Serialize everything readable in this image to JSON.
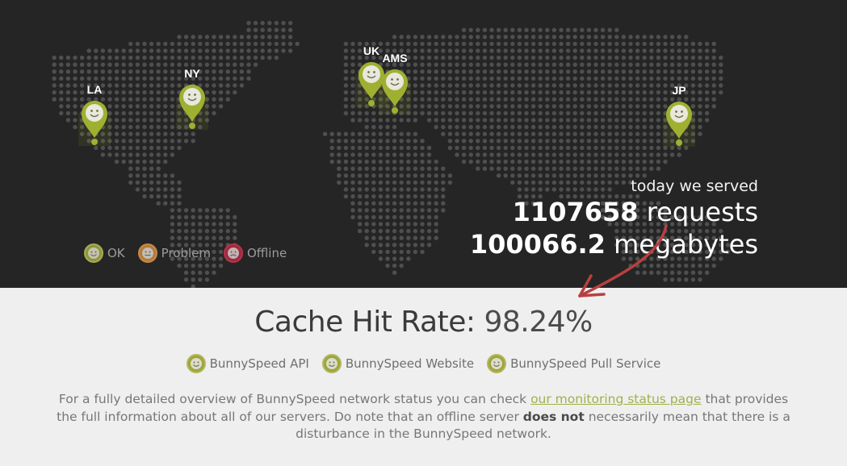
{
  "map": {
    "locations": [
      {
        "code": "LA",
        "status": "ok"
      },
      {
        "code": "NY",
        "status": "ok"
      },
      {
        "code": "UK",
        "status": "ok"
      },
      {
        "code": "AMS",
        "status": "ok"
      },
      {
        "code": "JP",
        "status": "ok"
      }
    ],
    "colors": {
      "ok": "#9fb031",
      "problem": "#c9894a",
      "offline": "#b8324a",
      "background": "#252525",
      "dots": "#4f4f4f"
    }
  },
  "legend": {
    "ok": "OK",
    "problem": "Problem",
    "offline": "Offline"
  },
  "stats": {
    "caption": "today we served",
    "requests_value": "1107658",
    "requests_unit": "requests",
    "megabytes_value": "100066.2",
    "megabytes_unit": "megabytes"
  },
  "cache": {
    "label": "Cache Hit Rate:",
    "value": "98.24%"
  },
  "services": [
    {
      "label": "BunnySpeed API",
      "status": "ok"
    },
    {
      "label": "BunnySpeed Website",
      "status": "ok"
    },
    {
      "label": "BunnySpeed Pull Service",
      "status": "ok"
    }
  ],
  "notice": {
    "before_link": "For a fully detailed overview of BunnySpeed network status you can check",
    "link": "our monitoring status page",
    "after_link": "that provides the full information about all of our servers. Do note that an offline server",
    "bold": "does not",
    "end": "necessarily mean that there is a disturbance in the BunnySpeed network."
  }
}
